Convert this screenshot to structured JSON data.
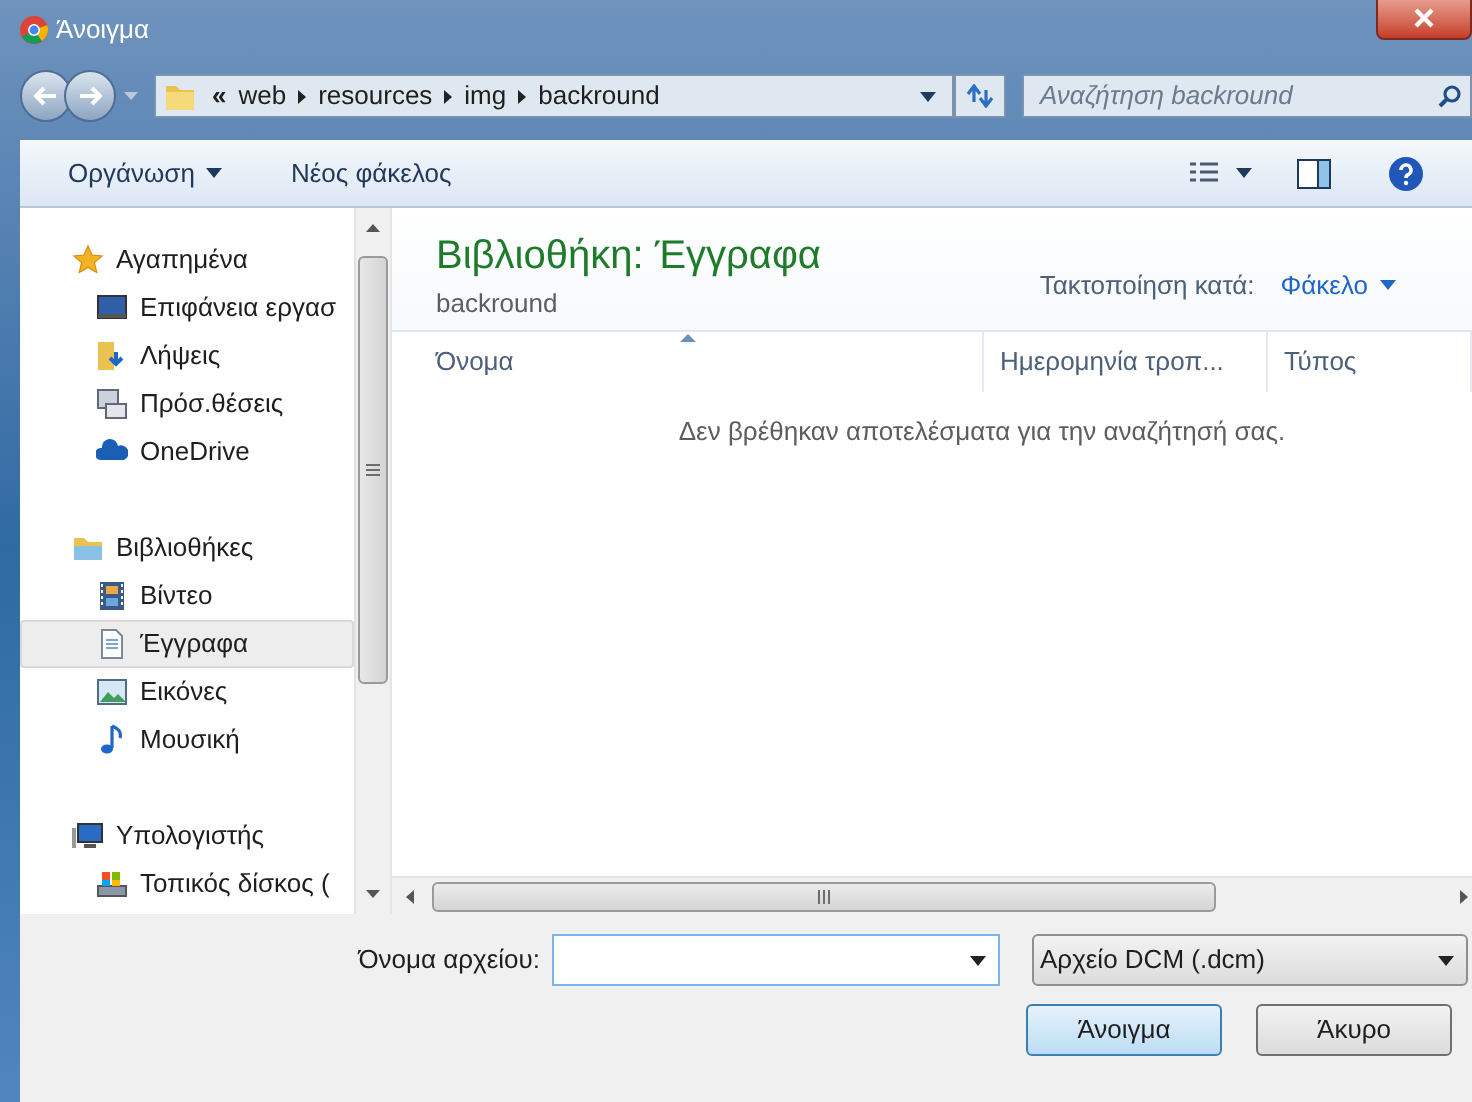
{
  "window": {
    "title": "Άνοιγμα"
  },
  "address_bar": {
    "overflow": "«",
    "crumbs": [
      "web",
      "resources",
      "img",
      "backround"
    ]
  },
  "search": {
    "placeholder": "Αναζήτηση backround"
  },
  "toolbar": {
    "organize": "Οργάνωση",
    "new_folder": "Νέος φάκελος"
  },
  "navigation": [
    {
      "label": "Αγαπημένα",
      "selected": false,
      "children": [
        {
          "label": "Επιφάνεια εργασ",
          "selected": false
        },
        {
          "label": "Λήψεις",
          "selected": false
        },
        {
          "label": "Πρόσ.θέσεις",
          "selected": false
        },
        {
          "label": "OneDrive",
          "selected": false
        }
      ]
    },
    {
      "label": "Βιβλιοθήκες",
      "selected": false,
      "children": [
        {
          "label": "Βίντεο",
          "selected": false
        },
        {
          "label": "Έγγραφα",
          "selected": true
        },
        {
          "label": "Εικόνες",
          "selected": false
        },
        {
          "label": "Μουσική",
          "selected": false
        }
      ]
    },
    {
      "label": "Υπολογιστής",
      "selected": false,
      "children": [
        {
          "label": "Τοπικός δίσκος (",
          "selected": false
        }
      ]
    }
  ],
  "library": {
    "title": "Βιβλιοθήκη: Έγγραφα",
    "subtitle": "backround",
    "arrange_label": "Τακτοποίηση κατά:",
    "arrange_value": "Φάκελο"
  },
  "columns": [
    {
      "label": "Όνομα",
      "sorted": true
    },
    {
      "label": "Ημερομηνία τροπ...",
      "sorted": false
    },
    {
      "label": "Τύπος",
      "sorted": false
    }
  ],
  "empty_message": "Δεν βρέθηκαν αποτελέσματα για την αναζήτησή σας.",
  "footer": {
    "filename_label": "Όνομα αρχείου:",
    "filetype": "Αρχείο DCM (.dcm)",
    "buttons": [
      {
        "label": "Άνοιγμα",
        "default": true
      },
      {
        "label": "Άκυρο",
        "default": false
      }
    ]
  }
}
